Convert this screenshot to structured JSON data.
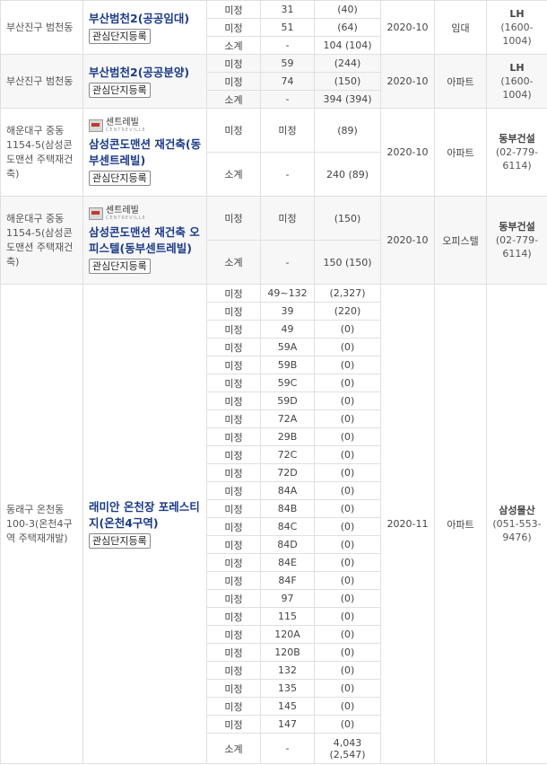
{
  "groups": [
    {
      "location": "부산진구 범천동",
      "logo": null,
      "name": "부산범천2(공공임대)",
      "button": "관심단지등록",
      "date": "2020-10",
      "type": "임대",
      "company": "LH",
      "phone": "(1600-1004)",
      "shaded": false,
      "rows": [
        {
          "cat": "미정",
          "area": "31",
          "units": "(40)",
          "h": 20
        },
        {
          "cat": "미정",
          "area": "51",
          "units": "(64)",
          "h": 20
        },
        {
          "cat": "소계",
          "area": "-",
          "units": "104 (104)",
          "h": 20
        }
      ]
    },
    {
      "location": "부산진구 범천동",
      "logo": null,
      "name": "부산범천2(공공분양)",
      "button": "관심단지등록",
      "date": "2020-10",
      "type": "아파트",
      "company": "LH",
      "phone": "(1600-1004)",
      "shaded": true,
      "rows": [
        {
          "cat": "미정",
          "area": "59",
          "units": "(244)",
          "h": 20
        },
        {
          "cat": "미정",
          "area": "74",
          "units": "(150)",
          "h": 20
        },
        {
          "cat": "소계",
          "area": "-",
          "units": "394 (394)",
          "h": 20
        }
      ]
    },
    {
      "location": "해운대구 중동 1154-5(삼성콘도맨션 주택재건축)",
      "logo": {
        "text": "센트레빌",
        "sub": "CENTREVILLE"
      },
      "name": "삼성콘도맨션 재건축(동부센트레빌)",
      "button": "관심단지등록",
      "date": "2020-10",
      "type": "아파트",
      "company": "동부건설",
      "phone": "(02-779-6114)",
      "shaded": false,
      "rows": [
        {
          "cat": "미정",
          "area": "미정",
          "units": "(89)",
          "h": 49
        },
        {
          "cat": "소계",
          "area": "-",
          "units": "240 (89)",
          "h": 49
        }
      ]
    },
    {
      "location": "해운대구 중동 1154-5(삼성콘도맨션 주택재건축)",
      "logo": {
        "text": "센트레빌",
        "sub": "CENTREVILLE"
      },
      "name": "삼성콘도맨션 재건축 오피스텔(동부센트레빌)",
      "button": "관심단지등록",
      "date": "2020-10",
      "type": "오피스텔",
      "company": "동부건설",
      "phone": "(02-779-6114)",
      "shaded": true,
      "rows": [
        {
          "cat": "미정",
          "area": "미정",
          "units": "(150)",
          "h": 49
        },
        {
          "cat": "소계",
          "area": "-",
          "units": "150 (150)",
          "h": 49
        }
      ]
    },
    {
      "location": "동래구 온천동 100-3(온천4구역 주택재개발)",
      "logo": null,
      "name": "래미안 온천장 포레스티지(온천4구역)",
      "button": "관심단지등록",
      "date": "2020-11",
      "type": "아파트",
      "company": "삼성물산",
      "phone": "(051-553-9476)",
      "shaded": false,
      "rows": [
        {
          "cat": "미정",
          "area": "49~132",
          "units": "(2,327)",
          "h": 20
        },
        {
          "cat": "미정",
          "area": "39",
          "units": "(220)",
          "h": 20
        },
        {
          "cat": "미정",
          "area": "49",
          "units": "(0)",
          "h": 20
        },
        {
          "cat": "미정",
          "area": "59A",
          "units": "(0)",
          "h": 20
        },
        {
          "cat": "미정",
          "area": "59B",
          "units": "(0)",
          "h": 20
        },
        {
          "cat": "미정",
          "area": "59C",
          "units": "(0)",
          "h": 20
        },
        {
          "cat": "미정",
          "area": "59D",
          "units": "(0)",
          "h": 20
        },
        {
          "cat": "미정",
          "area": "72A",
          "units": "(0)",
          "h": 20
        },
        {
          "cat": "미정",
          "area": "29B",
          "units": "(0)",
          "h": 20
        },
        {
          "cat": "미정",
          "area": "72C",
          "units": "(0)",
          "h": 20
        },
        {
          "cat": "미정",
          "area": "72D",
          "units": "(0)",
          "h": 20
        },
        {
          "cat": "미정",
          "area": "84A",
          "units": "(0)",
          "h": 20
        },
        {
          "cat": "미정",
          "area": "84B",
          "units": "(0)",
          "h": 20
        },
        {
          "cat": "미정",
          "area": "84C",
          "units": "(0)",
          "h": 20
        },
        {
          "cat": "미정",
          "area": "84D",
          "units": "(0)",
          "h": 20
        },
        {
          "cat": "미정",
          "area": "84E",
          "units": "(0)",
          "h": 20
        },
        {
          "cat": "미정",
          "area": "84F",
          "units": "(0)",
          "h": 20
        },
        {
          "cat": "미정",
          "area": "97",
          "units": "(0)",
          "h": 20
        },
        {
          "cat": "미정",
          "area": "115",
          "units": "(0)",
          "h": 20
        },
        {
          "cat": "미정",
          "area": "120A",
          "units": "(0)",
          "h": 20
        },
        {
          "cat": "미정",
          "area": "120B",
          "units": "(0)",
          "h": 20
        },
        {
          "cat": "미정",
          "area": "132",
          "units": "(0)",
          "h": 20
        },
        {
          "cat": "미정",
          "area": "135",
          "units": "(0)",
          "h": 20
        },
        {
          "cat": "미정",
          "area": "145",
          "units": "(0)",
          "h": 20
        },
        {
          "cat": "미정",
          "area": "147",
          "units": "(0)",
          "h": 20
        },
        {
          "cat": "소계",
          "area": "-",
          "units": "4,043 (2,547)",
          "h": 34
        }
      ]
    }
  ]
}
